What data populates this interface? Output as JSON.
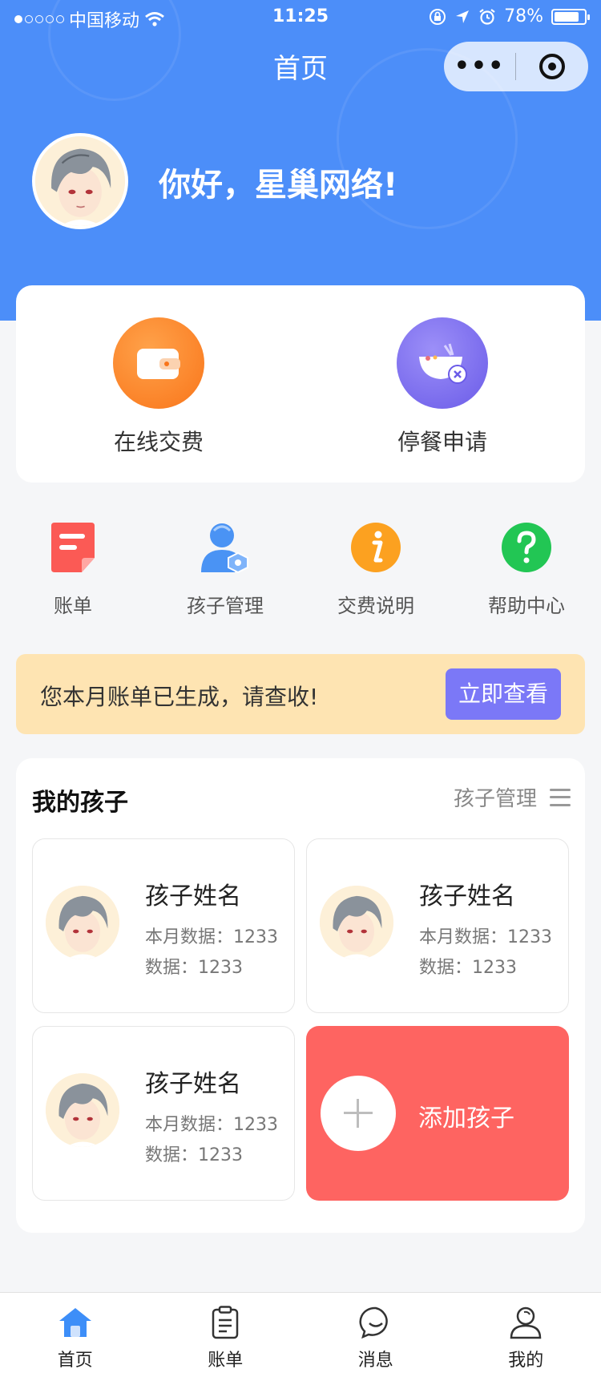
{
  "status_bar": {
    "carrier": "中国移动",
    "time": "11:25",
    "battery": "78%",
    "battery_level": 0.78
  },
  "nav": {
    "title": "首页",
    "more_label": "•••"
  },
  "profile": {
    "greeting": "你好，星巢网络!"
  },
  "quick_actions": [
    {
      "label": "在线交费",
      "icon": "wallet-icon",
      "color": "#fb8422"
    },
    {
      "label": "停餐申请",
      "icon": "bowl-cancel-icon",
      "color": "#7b6cf2"
    }
  ],
  "functions": [
    {
      "label": "账单",
      "icon": "bill-icon",
      "color": "#fb5a55"
    },
    {
      "label": "孩子管理",
      "icon": "child-manage-icon",
      "color": "#4a93f4"
    },
    {
      "label": "交费说明",
      "icon": "info-icon",
      "color": "#fca120"
    },
    {
      "label": "帮助中心",
      "icon": "help-icon",
      "color": "#22c654"
    }
  ],
  "notice": {
    "text": "您本月账单已生成，请查收!",
    "button": "立即查看"
  },
  "children_section": {
    "title": "我的孩子",
    "manage_label": "孩子管理",
    "children": [
      {
        "name": "孩子姓名",
        "monthly": "本月数据：1233",
        "data": "数据：1233"
      },
      {
        "name": "孩子姓名",
        "monthly": "本月数据：1233",
        "data": "数据：1233"
      },
      {
        "name": "孩子姓名",
        "monthly": "本月数据：1233",
        "data": "数据：1233"
      }
    ],
    "add_label": "添加孩子"
  },
  "tabbar": {
    "items": [
      {
        "label": "首页",
        "icon": "home-icon",
        "active": true
      },
      {
        "label": "账单",
        "icon": "clipboard-icon",
        "active": false
      },
      {
        "label": "消息",
        "icon": "chat-icon",
        "active": false
      },
      {
        "label": "我的",
        "icon": "user-icon",
        "active": false
      }
    ]
  },
  "colors": {
    "header_blue": "#4c8ef9",
    "notice_bg": "#fee4b2",
    "notice_button": "#7b78f7",
    "add_card": "#fe6461"
  }
}
